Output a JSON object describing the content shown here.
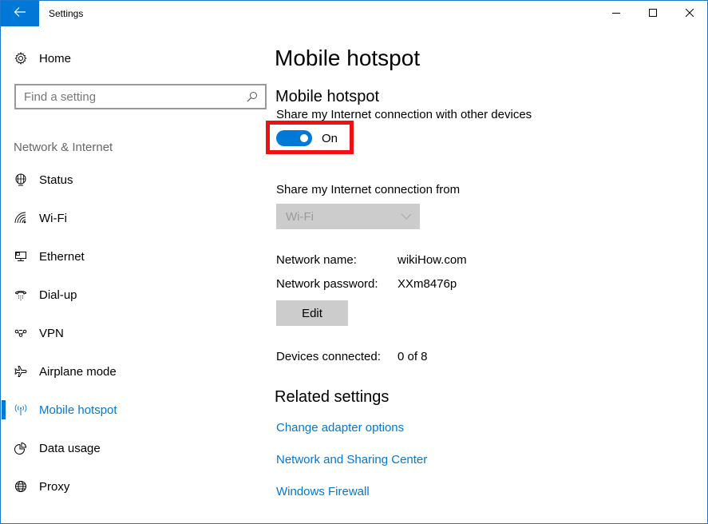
{
  "window": {
    "title": "Settings",
    "accent_color": "#0078d7",
    "controls": {
      "back": "back-arrow-icon",
      "minimize": "minimize-icon",
      "maximize": "maximize-icon",
      "close": "close-icon"
    }
  },
  "sidebar": {
    "home": {
      "label": "Home",
      "icon": "gear-icon"
    },
    "search": {
      "placeholder": "Find a setting",
      "value": "",
      "icon": "search-icon"
    },
    "section_label": "Network & Internet",
    "items": [
      {
        "label": "Status",
        "icon": "network-status-icon",
        "active": false
      },
      {
        "label": "Wi-Fi",
        "icon": "wifi-icon",
        "active": false
      },
      {
        "label": "Ethernet",
        "icon": "ethernet-icon",
        "active": false
      },
      {
        "label": "Dial-up",
        "icon": "dialup-phone-icon",
        "active": false
      },
      {
        "label": "VPN",
        "icon": "vpn-icon",
        "active": false
      },
      {
        "label": "Airplane mode",
        "icon": "airplane-icon",
        "active": false
      },
      {
        "label": "Mobile hotspot",
        "icon": "hotspot-icon",
        "active": true
      },
      {
        "label": "Data usage",
        "icon": "data-usage-icon",
        "active": false
      },
      {
        "label": "Proxy",
        "icon": "globe-icon",
        "active": false
      }
    ]
  },
  "main": {
    "page_title": "Mobile hotspot",
    "hotspot": {
      "heading": "Mobile hotspot",
      "description": "Share my Internet connection with other devices",
      "toggle_state": "On",
      "toggle_on": true,
      "highlight_color": "#ee1111"
    },
    "share_from": {
      "label": "Share my Internet connection from",
      "selected": "Wi-Fi",
      "disabled": true
    },
    "network_name": {
      "label": "Network name:",
      "value": "wikiHow.com"
    },
    "network_password": {
      "label": "Network password:",
      "value": "XXm8476p"
    },
    "edit_label": "Edit",
    "devices_connected": {
      "label": "Devices connected:",
      "value": "0 of 8"
    },
    "related": {
      "heading": "Related settings",
      "links": [
        "Change adapter options",
        "Network and Sharing Center",
        "Windows Firewall"
      ]
    }
  }
}
